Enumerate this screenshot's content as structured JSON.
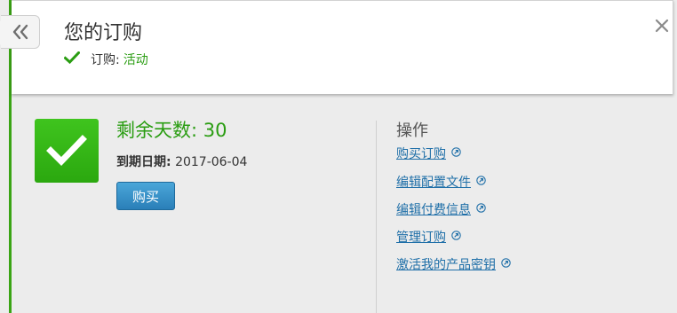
{
  "header": {
    "title": "您的订购",
    "status_label": "订购:",
    "status_value": "活动"
  },
  "subscription": {
    "days_label": "剩余天数:",
    "days_value": "30",
    "expiry_label": "到期日期:",
    "expiry_value": "2017-06-04",
    "buy_label": "购买"
  },
  "actions": {
    "title": "操作",
    "items": [
      {
        "label": "购买订购",
        "icon": "external-link-icon"
      },
      {
        "label": "编辑配置文件",
        "icon": "external-link-icon"
      },
      {
        "label": "编辑付费信息",
        "icon": "external-link-icon"
      },
      {
        "label": "管理订购",
        "icon": "external-link-icon"
      },
      {
        "label": "激活我的产品密钥",
        "icon": "external-link-icon"
      }
    ]
  },
  "colors": {
    "accent_green": "#2a9d12",
    "link_blue": "#1f6fa8",
    "button_blue": "#2a7fb8"
  }
}
